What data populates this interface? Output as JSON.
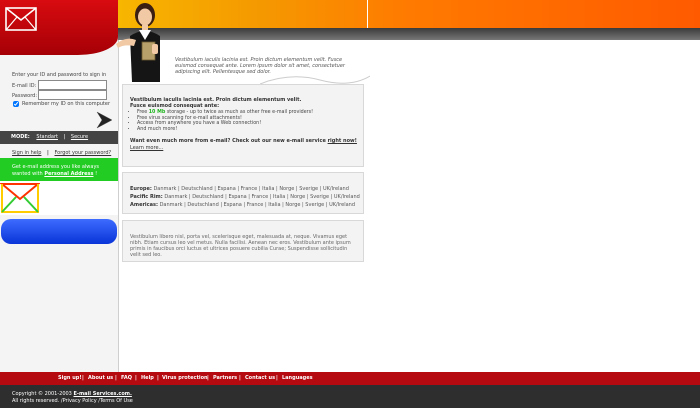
{
  "login": {
    "prompt": "Enter your ID and password to sign in",
    "email_label": "E-mail ID:",
    "password_label": "Password:",
    "remember_label": "Remember my ID on this computer"
  },
  "mode": {
    "label": "MODE:",
    "standard": "Standart",
    "secure": "Secure"
  },
  "help": {
    "sign_in_help": "Sign in help",
    "forgot_password": "Forgot your password?"
  },
  "promo": {
    "line1": "Get e-mail address you like always",
    "line2_prefix": "wanted with",
    "line2_link": "Personal Address",
    "line2_suffix": "!"
  },
  "intro": {
    "text": "Vestibulum iaculis lacinia est. Proin dictum elementum velit. Fusce euismod consequat ante. Lorem ipsum dolor sit amet, consectetuer adipiscing elit. Pellentesque sed dolor."
  },
  "panel1": {
    "head1": "Vestibulum iaculis lacinia est. Proin dictum elementum velit.",
    "head2": "Fusce euismod consequat ante:",
    "bullet1_prefix": "Free",
    "bullet1_highlight": "10 Mb",
    "bullet1_suffix": "storage - up to twice as much as other free e-mail providers!",
    "bullet2": "Free virus scanning for e-mail attachments!",
    "bullet3": "Access from anywhere you have a Web connection!",
    "bullet4": "And much more!",
    "question": "Want even much more from e-mail? Check out our new e-mail service",
    "question_link": "right now!",
    "learn_more": "Learn more..."
  },
  "regions": {
    "europe_label": "Europe:",
    "europe": "Danmark | Deutschland | Espana | France | Italia | Norge | Sverige | UK/Ireland",
    "pacific_label": "Pacific Rim:",
    "pacific": "Danmark | Deutschland | Espana | France | Italia | Norge | Sverige | UK/Ireland",
    "americas_label": "Americas:",
    "americas": "Danmark | Deutschland | Espana | France | Italia | Norge | Sverige | UK/Ireland"
  },
  "panel3": {
    "text": "Vestibulum libero nisl, porta vel, scelerisque eget, malesuada at, neque. Vivamus eget nibh. Etiam cursus leo vel metus. Nulla facilisi. Aenean nec eros. Vestibulum ante ipsum primis in faucibus orci luctus et ultrices posuere cubilia Curae; Suspendisse sollicitudin velit sed leo."
  },
  "footer": {
    "links": [
      "Sign up!",
      "About us",
      "FAQ",
      "Help",
      "Virus protection",
      "Partners",
      "Contact us",
      "Languages"
    ],
    "copyright_prefix": "Copyright © 2001-2003",
    "company": "E-mail Services.com.",
    "rights": "All rights reserved.",
    "privacy": "Privacy Policy",
    "terms": "Terms Of Use"
  },
  "colors": {
    "brand_red": "#b40a10",
    "accent_orange": "#ff7a00",
    "promo_green": "#22cc22",
    "pill_blue": "#0a34d8"
  }
}
